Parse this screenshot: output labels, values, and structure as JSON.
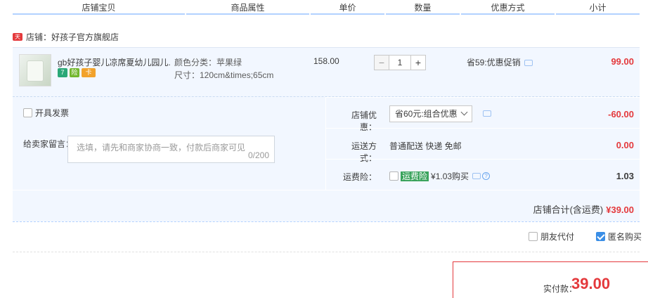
{
  "header": {
    "columns": [
      "店铺宝贝",
      "商品属性",
      "单价",
      "数量",
      "优惠方式",
      "小计"
    ]
  },
  "shop": {
    "icon_text": "天猫",
    "name": "店铺：好孩子官方旗舰店"
  },
  "item": {
    "title": "gb好孩子婴儿凉席夏幼儿园儿...",
    "attr_color": "颜色分类：苹果绿",
    "attr_size": "尺寸：120cm&times;65cm",
    "price": "158.00",
    "quantity": "1",
    "minus": "−",
    "plus": "+",
    "promo": "省59:优惠促销",
    "subtotal": "99.00",
    "badges": [
      "7",
      "险",
      "卡"
    ]
  },
  "invoice": {
    "label": "开具发票"
  },
  "message": {
    "label": "给卖家留言：",
    "placeholder": "选填，请先和商家协商一致，付款后商家可见",
    "counter": "0/200"
  },
  "store_discount": {
    "label": "店铺优惠：",
    "selected": "省60元:组合优惠",
    "amount": "-60.00"
  },
  "shipping": {
    "label": "运送方式：",
    "value": "普通配送 快递 免邮",
    "amount": "0.00"
  },
  "insurance": {
    "label": "运费险：",
    "tag": "运费险",
    "value": "¥1.03购买",
    "amount": "1.03"
  },
  "store_total": {
    "label": "店铺合计(含运费)",
    "amount": "¥39.00"
  },
  "bottom": {
    "friend_pay": "朋友代付",
    "anonymous": "匿名购买"
  },
  "pay": {
    "label": "实付款：",
    "amount": "39.00"
  },
  "colors": {
    "accent_red": "#e4393c",
    "accent_blue": "#3a8ee6",
    "panel_bg": "#f2f7ff"
  }
}
